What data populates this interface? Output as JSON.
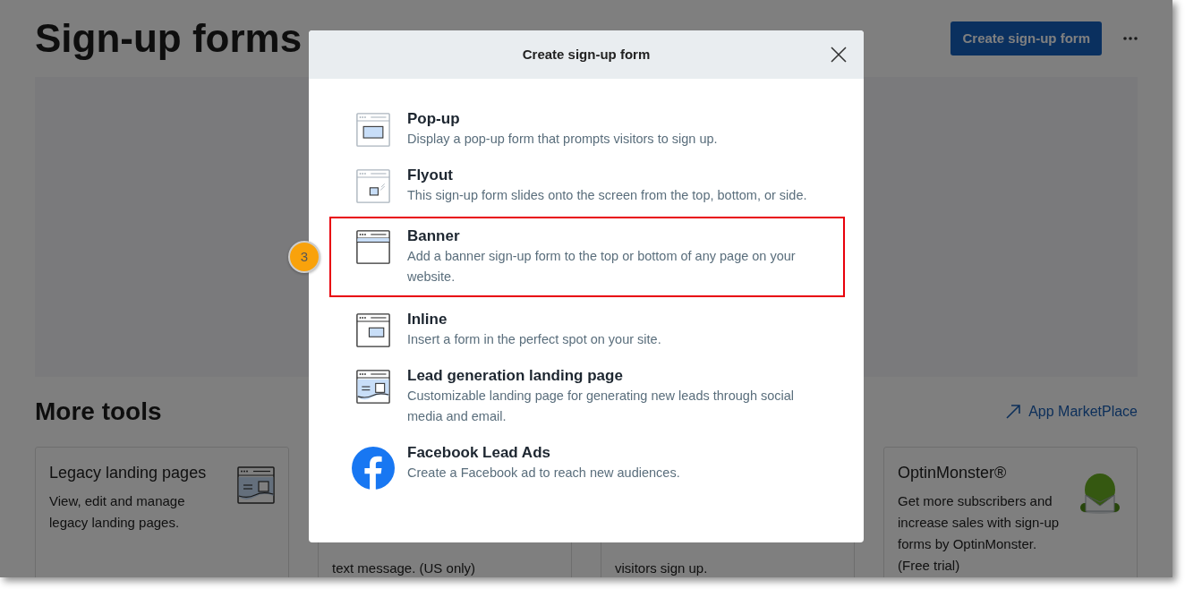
{
  "page": {
    "title": "Sign-up forms",
    "primary_button": "Create sign-up form"
  },
  "more_tools": {
    "title": "More tools",
    "link": "App MarketPlace",
    "cards": [
      {
        "title": "Legacy landing pages",
        "description": "View, edit and manage legacy landing pages.",
        "kind": "landing",
        "covered": false
      },
      {
        "description": "text message. (US only)",
        "covered": true
      },
      {
        "description": "visitors sign up.",
        "covered": true
      },
      {
        "title": "OptinMonster®",
        "description": "Get more subscribers and increase sales with sign-up forms by OptinMonster. (Free trial)",
        "kind": "mascot",
        "covered": false
      }
    ]
  },
  "modal": {
    "title": "Create sign-up form",
    "callout": "3",
    "options": [
      {
        "kind": "popup",
        "title": "Pop-up",
        "description": "Display a pop-up form that prompts visitors to sign up.",
        "highlighted": false
      },
      {
        "kind": "flyout",
        "title": "Flyout",
        "description": "This sign-up form slides onto the screen from the top, bottom, or side.",
        "highlighted": false
      },
      {
        "kind": "banner",
        "title": "Banner",
        "description": "Add a banner sign-up form to the top or bottom of any page on your website.",
        "highlighted": true
      },
      {
        "kind": "inline",
        "title": "Inline",
        "description": "Insert a form in the perfect spot on your site.",
        "highlighted": false
      },
      {
        "kind": "landing",
        "title": "Lead generation landing page",
        "description": "Customizable landing page for generating new leads through social media and email.",
        "highlighted": false
      },
      {
        "kind": "facebook",
        "title": "Facebook Lead Ads",
        "description": "Create a Facebook ad to reach new audiences.",
        "highlighted": false
      }
    ]
  }
}
